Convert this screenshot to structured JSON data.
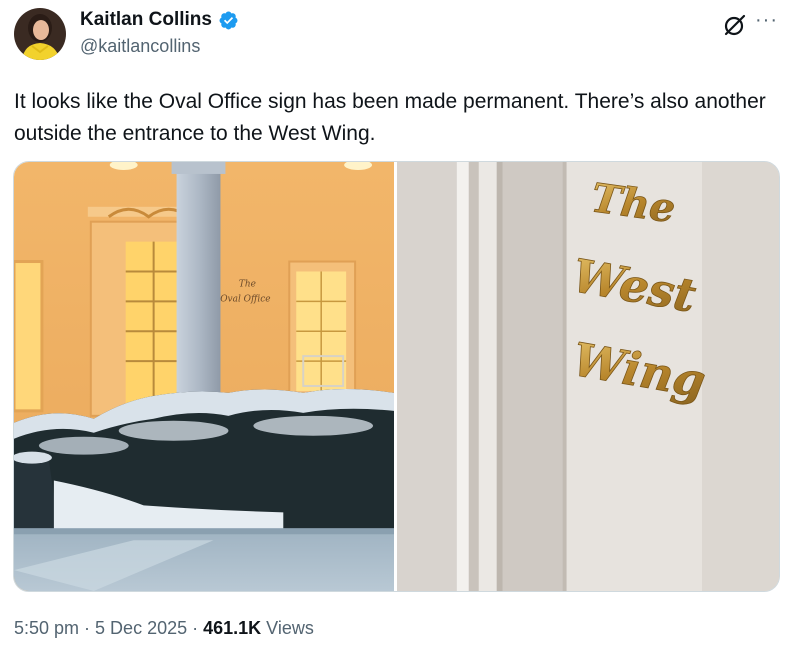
{
  "author": {
    "display_name": "Kaitlan Collins",
    "handle": "@kaitlancollins",
    "verified_icon": "verified-badge-icon",
    "verified_color": "#1d9bf0"
  },
  "actions": {
    "grok_icon": "grok-icon",
    "more_label": "···"
  },
  "tweet": {
    "text": "It looks like the Oval Office sign has been made permanent. There’s also another outside the entrance to the West Wing."
  },
  "media": {
    "left_sign_line1": "The",
    "left_sign_line2": "Oval Office",
    "right_sign_line1": "The",
    "right_sign_line2": "West",
    "right_sign_line3": "Wing"
  },
  "meta": {
    "time": "5:50 pm",
    "separator1": "·",
    "date": "5 Dec 2025",
    "separator2": "·",
    "views_count": "461.1K",
    "views_label": "Views"
  }
}
